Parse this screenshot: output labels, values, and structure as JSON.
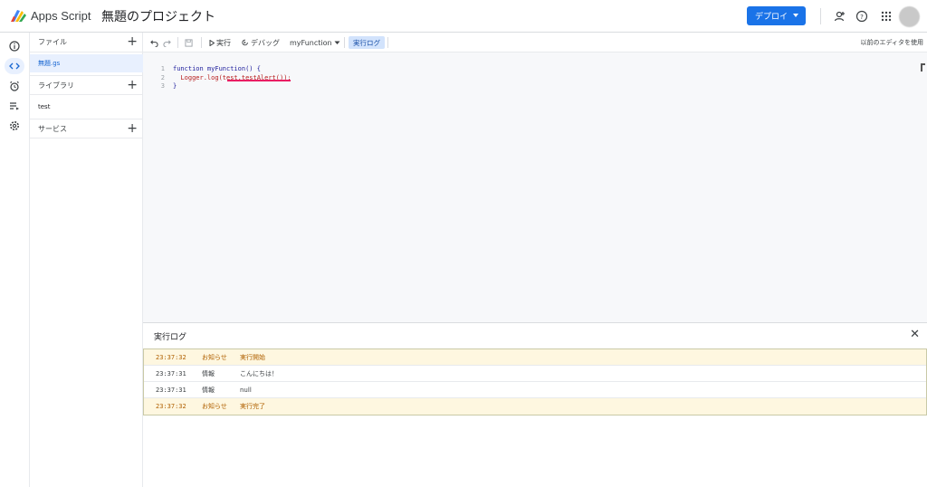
{
  "header": {
    "app_name": "Apps Script",
    "project_title": "無題のプロジェクト",
    "deploy_label": "デプロイ"
  },
  "sidebar": {
    "files_label": "ファイル",
    "files": [
      {
        "label": "無題.gs"
      }
    ],
    "libraries_label": "ライブラリ",
    "libraries": [
      {
        "label": "test"
      }
    ],
    "services_label": "サービス"
  },
  "toolbar": {
    "run_label": "実行",
    "debug_label": "デバッグ",
    "function_select": "myFunction",
    "exec_log_label": "実行ログ",
    "old_editor_label": "以前のエディタを使用"
  },
  "editor": {
    "line_numbers": [
      "1",
      "2",
      "3"
    ],
    "lines": [
      "function myFunction() {",
      "  Logger.log(test.testAlert());",
      "}"
    ]
  },
  "log": {
    "title": "実行ログ",
    "rows": [
      {
        "time": "23:37:32",
        "level": "お知らせ",
        "message": "実行開始",
        "type": "notice"
      },
      {
        "time": "23:37:31",
        "level": "情報",
        "message": "こんにちは！",
        "type": "info"
      },
      {
        "time": "23:37:31",
        "level": "情報",
        "message": "null",
        "type": "info"
      },
      {
        "time": "23:37:32",
        "level": "お知らせ",
        "message": "実行完了",
        "type": "notice"
      }
    ]
  },
  "colors": {
    "accent": "#1a73e8",
    "notice_bg": "#fef7e0",
    "notice_text": "#b06000",
    "error_underline": "#e91e63"
  }
}
